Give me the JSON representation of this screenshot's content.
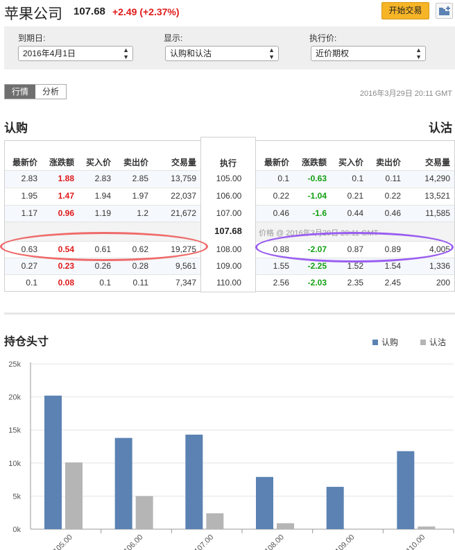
{
  "header": {
    "company": "苹果公司",
    "price": "107.68",
    "change": "+2.49 (+2.37%)",
    "trade_button": "开始交易"
  },
  "filters": {
    "expiry_label": "到期日:",
    "expiry_value": "2016年4月1日",
    "display_label": "显示:",
    "display_value": "认购和认沽",
    "strike_label": "执行价:",
    "strike_value": "近价期权"
  },
  "tabs": [
    "行情",
    "分析"
  ],
  "timestamp": "2016年3月29日 20:11 GMT",
  "sections": {
    "calls": "认购",
    "puts": "认沽"
  },
  "table": {
    "headers": [
      "最新价",
      "涨跌额",
      "买入价",
      "卖出价",
      "交易量"
    ],
    "strike_header": "执行",
    "current_price": "107.68",
    "current_note": "价格 @ 2016年3月29日 20:11 GMT",
    "rows_above": [
      {
        "strike": "105.00",
        "call": [
          "2.83",
          "1.88",
          "2.83",
          "2.85",
          "13,759"
        ],
        "put": [
          "0.1",
          "-0.63",
          "0.1",
          "0.11",
          "14,290"
        ]
      },
      {
        "strike": "106.00",
        "call": [
          "1.95",
          "1.47",
          "1.94",
          "1.97",
          "22,037"
        ],
        "put": [
          "0.22",
          "-1.04",
          "0.21",
          "0.22",
          "13,521"
        ]
      },
      {
        "strike": "107.00",
        "call": [
          "1.17",
          "0.96",
          "1.19",
          "1.2",
          "21,672"
        ],
        "put": [
          "0.46",
          "-1.6",
          "0.44",
          "0.46",
          "11,585"
        ]
      }
    ],
    "rows_below": [
      {
        "strike": "108.00",
        "call": [
          "0.63",
          "0.54",
          "0.61",
          "0.62",
          "19,275"
        ],
        "put": [
          "0.88",
          "-2.07",
          "0.87",
          "0.89",
          "4,005"
        ]
      },
      {
        "strike": "109.00",
        "call": [
          "0.27",
          "0.23",
          "0.26",
          "0.28",
          "9,561"
        ],
        "put": [
          "1.55",
          "-2.25",
          "1.52",
          "1.54",
          "1,336"
        ]
      },
      {
        "strike": "110.00",
        "call": [
          "0.1",
          "0.08",
          "0.1",
          "0.11",
          "7,347"
        ],
        "put": [
          "2.56",
          "-2.03",
          "2.35",
          "2.45",
          "200"
        ]
      }
    ]
  },
  "colors": {
    "up": "#e01a1a",
    "down": "#12a012",
    "call_bar": "#5b82b3",
    "put_bar": "#b5b5b5"
  },
  "chart_data": {
    "type": "bar",
    "title": "持仓头寸",
    "categories": [
      "105.00",
      "106.00",
      "107.00",
      "108.00",
      "109.00",
      "110.00"
    ],
    "series": [
      {
        "name": "认购",
        "values": [
          20200,
          13800,
          14300,
          7900,
          6400,
          11800
        ]
      },
      {
        "name": "认沽",
        "values": [
          10100,
          5000,
          2400,
          900,
          0,
          400
        ]
      }
    ],
    "ylim": [
      0,
      25000
    ],
    "yticks": [
      "0k",
      "5k",
      "10k",
      "15k",
      "20k",
      "25k"
    ],
    "grid": true,
    "legend": "top-right"
  }
}
